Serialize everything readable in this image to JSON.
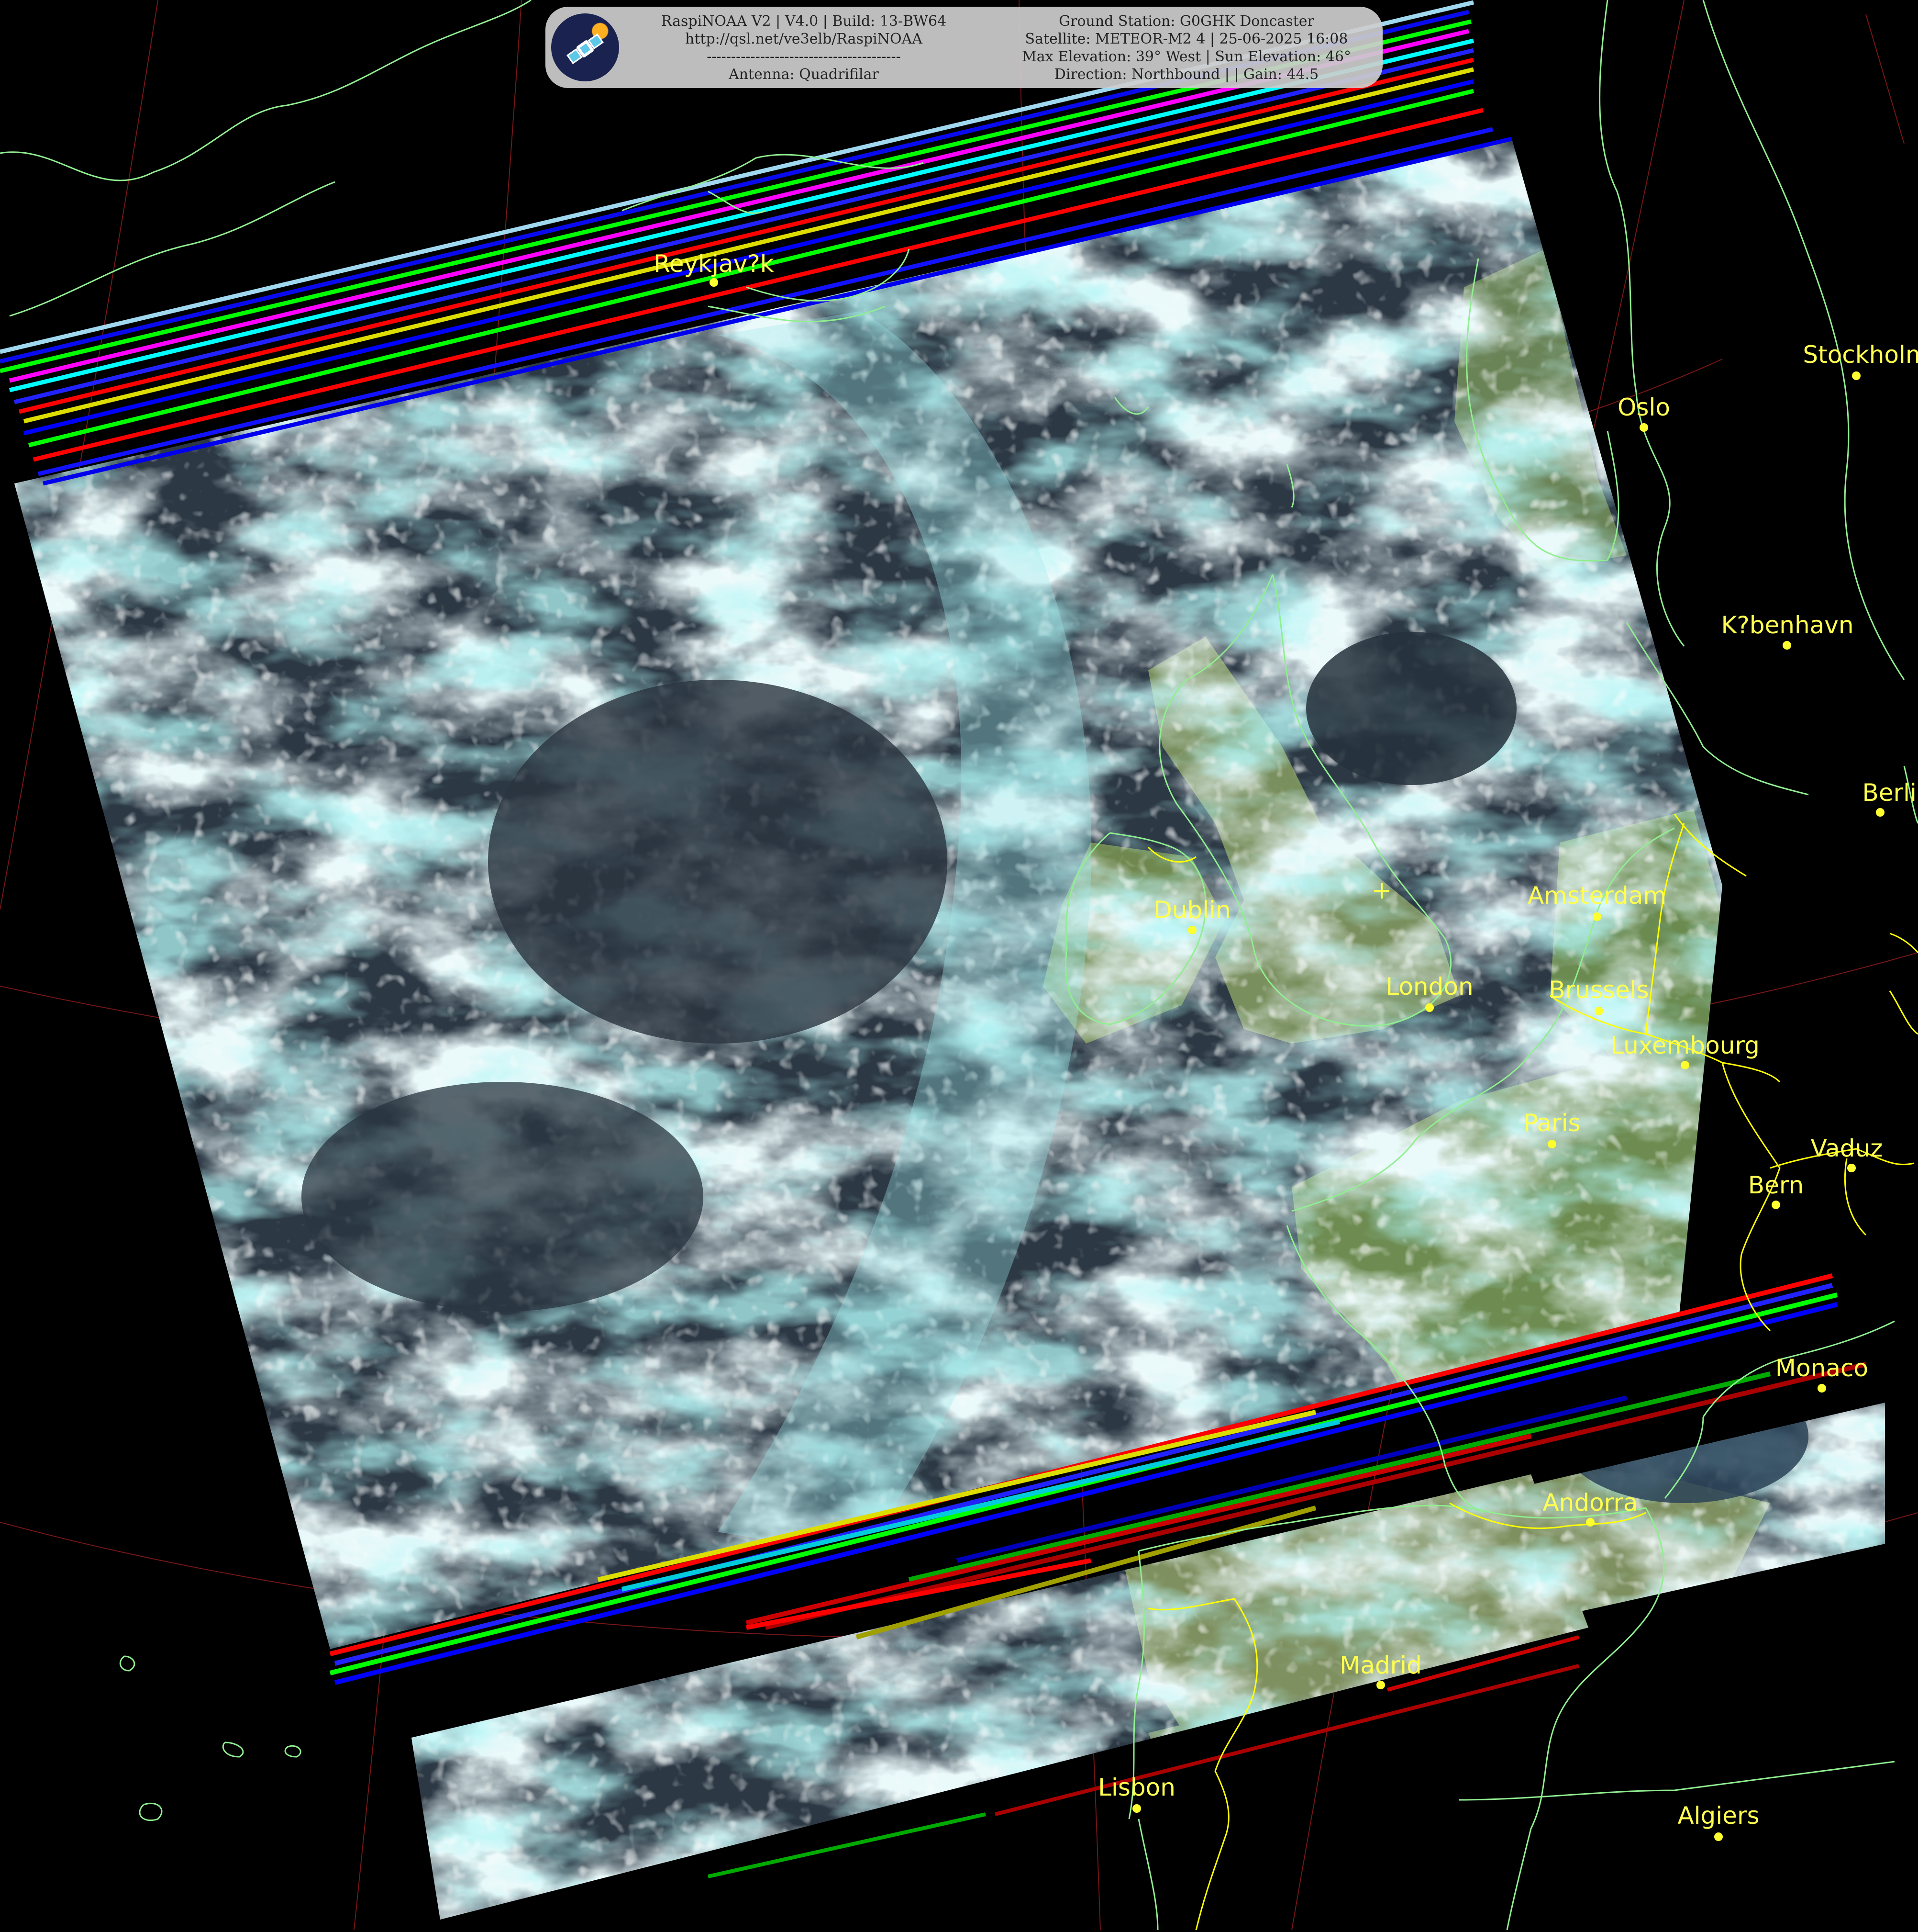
{
  "header": {
    "left_lines": [
      "RaspiNOAA V2 | V4.0 | Build: 13-BW64",
      "http://qsl.net/ve3elb/RaspiNOAA",
      "----------------------------------------",
      "Antenna: Quadrifilar"
    ],
    "right_lines": [
      "Ground Station: G0GHK Doncaster",
      "Satellite: METEOR-M2 4 | 25-06-2025 16:08",
      "Max Elevation: 39° West | Sun Elevation: 46°",
      "Direction: Northbound | | Gain: 44.5"
    ],
    "logo_icon": "satellite-icon"
  },
  "cities": [
    {
      "name": "Reykjav?k"
    },
    {
      "name": "Stockholm"
    },
    {
      "name": "Oslo"
    },
    {
      "name": "K?benhavn"
    },
    {
      "name": "Berlin"
    },
    {
      "name": "Amsterdam"
    },
    {
      "name": "Dublin"
    },
    {
      "name": "London"
    },
    {
      "name": "Brussels"
    },
    {
      "name": "Luxembourg"
    },
    {
      "name": "Paris"
    },
    {
      "name": "Vaduz"
    },
    {
      "name": "Bern"
    },
    {
      "name": "Monaco"
    },
    {
      "name": "Andorra"
    },
    {
      "name": "Madrid"
    },
    {
      "name": "Lisbon"
    },
    {
      "name": "Algiers"
    }
  ],
  "colors": {
    "background": "#000000",
    "coastline": "#90ee90",
    "border": "#ffff00",
    "graticule": "#8b1a1a",
    "city_label": "#ffff50",
    "cloud": "#dff4f4",
    "cloud_cyan": "#7fe6e6",
    "ocean": "#2b3640",
    "land": "#6f8b55"
  }
}
